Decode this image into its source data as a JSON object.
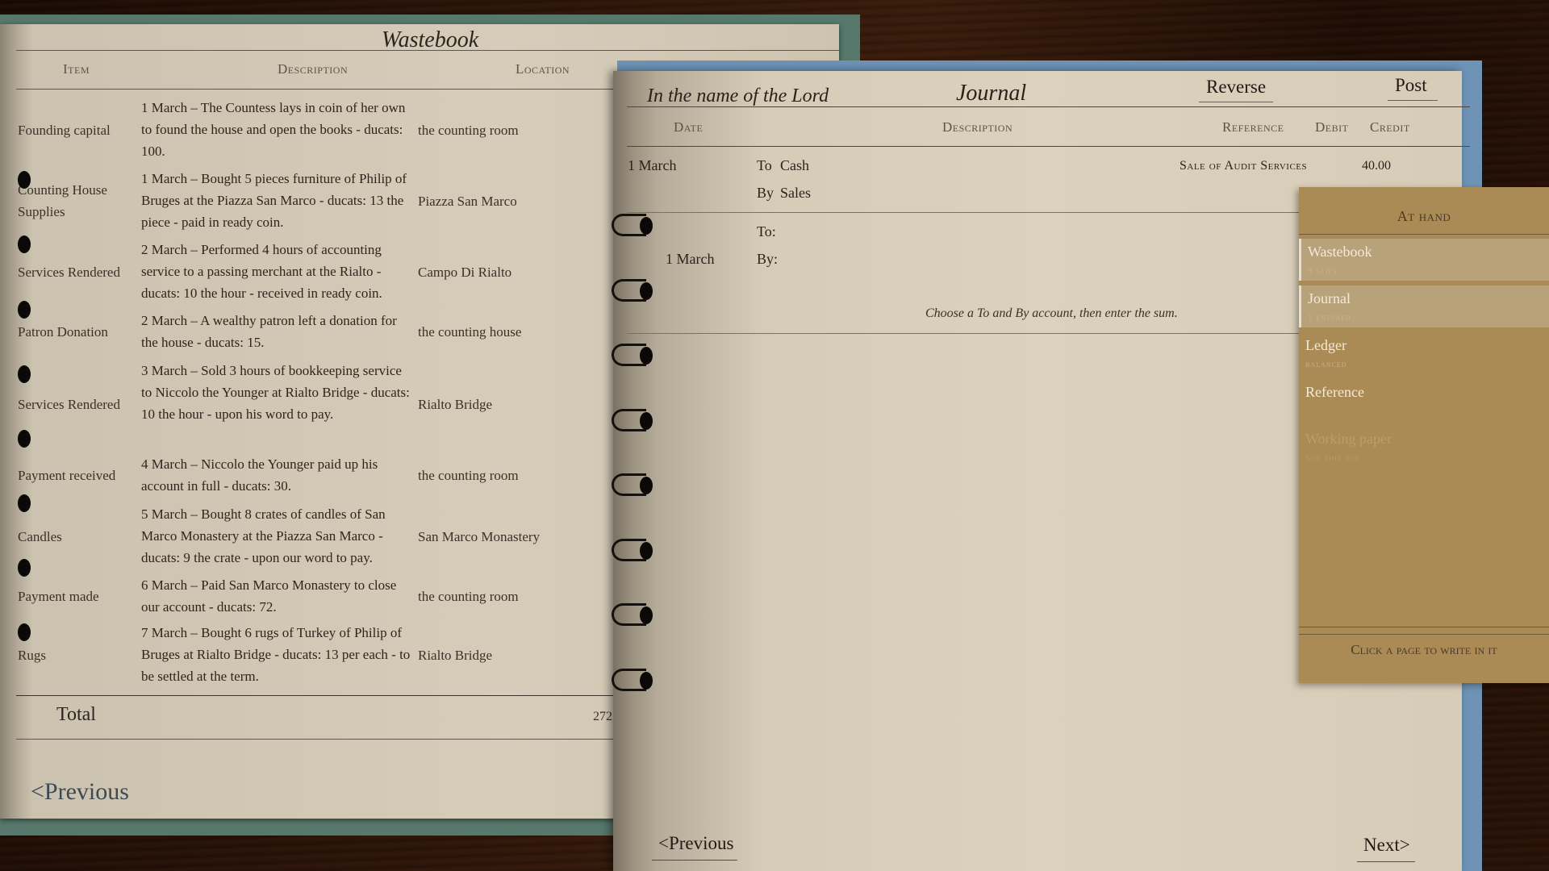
{
  "wastebook": {
    "title": "Wastebook",
    "headers": {
      "item": "Item",
      "description": "Description",
      "location": "Location"
    },
    "rows": [
      {
        "item": "Founding capital",
        "description": "1 March – The Countess lays in coin of her own to found the house and open the books - ducats: 100.",
        "location": "the counting room"
      },
      {
        "item": "Counting House Supplies",
        "description": "1 March – Bought 5 pieces furniture of Philip of Bruges at the Piazza San Marco - ducats: 13 the piece - paid in ready coin.",
        "location": "Piazza San Marco"
      },
      {
        "item": "Services Rendered",
        "description": "2 March – Performed 4 hours of accounting service to a passing merchant at the Rialto - ducats: 10 the hour - received in ready coin.",
        "location": "Campo Di Rialto"
      },
      {
        "item": "Patron Donation",
        "description": "2 March – A wealthy patron left a donation for the house - ducats: 15.",
        "location": "the counting house"
      },
      {
        "item": "Services Rendered",
        "description": "3 March – Sold 3 hours of bookkeeping service to Niccolo the Younger at Rialto Bridge - ducats: 10 the hour - upon his word to pay.",
        "location": "Rialto Bridge"
      },
      {
        "item": "Payment received",
        "description": "4 March – Niccolo the Younger paid up his account in full - ducats: 30.",
        "location": "the counting room"
      },
      {
        "item": "Candles",
        "description": "5 March – Bought 8 crates of candles of San Marco Monastery at the Piazza San Marco - ducats: 9 the crate - upon our word to pay.",
        "location": "San Marco Monastery"
      },
      {
        "item": "Payment made",
        "description": "6 March – Paid San Marco Monastery to close our account - ducats: 72.",
        "location": "the counting room"
      },
      {
        "item": "Rugs",
        "description": "7 March – Bought 6 rugs of Turkey of Philip of Bruges at Rialto Bridge - ducats: 13 per each - to be settled at the term.",
        "location": "Rialto Bridge"
      }
    ],
    "total_label": "Total",
    "total_value": "272",
    "previous": "<Previous"
  },
  "journal": {
    "invocation": "In the name of the Lord",
    "title": "Journal",
    "reverse": "Reverse",
    "post": "Post",
    "headers": {
      "date": "Date",
      "description": "Description",
      "reference": "Reference",
      "debit": "Debit",
      "credit": "Credit"
    },
    "entry1": {
      "date": "1 March",
      "to_prefix": "To",
      "to_account": "Cash",
      "by_prefix": "By",
      "by_account": "Sales",
      "reference": "Sale of Audit Services",
      "debit": "40.00"
    },
    "entry2": {
      "date": "1 March",
      "to_label": "To:",
      "by_label": "By:"
    },
    "hint": "Choose a To and By account, then enter the sum.",
    "previous": "<Previous",
    "next": "Next>"
  },
  "at_hand": {
    "title": "At hand",
    "items": [
      {
        "label": "Wastebook",
        "sub": "9 slips",
        "active": true
      },
      {
        "label": "Journal",
        "sub": "1 entered",
        "active": true
      },
      {
        "label": "Ledger",
        "sub": "balanced",
        "active": false
      },
      {
        "label": "Reference",
        "sub": "",
        "active": false
      },
      {
        "label": "Working paper",
        "sub": "not this job",
        "disabled": true
      }
    ],
    "footer": "Click a page to write in it"
  }
}
